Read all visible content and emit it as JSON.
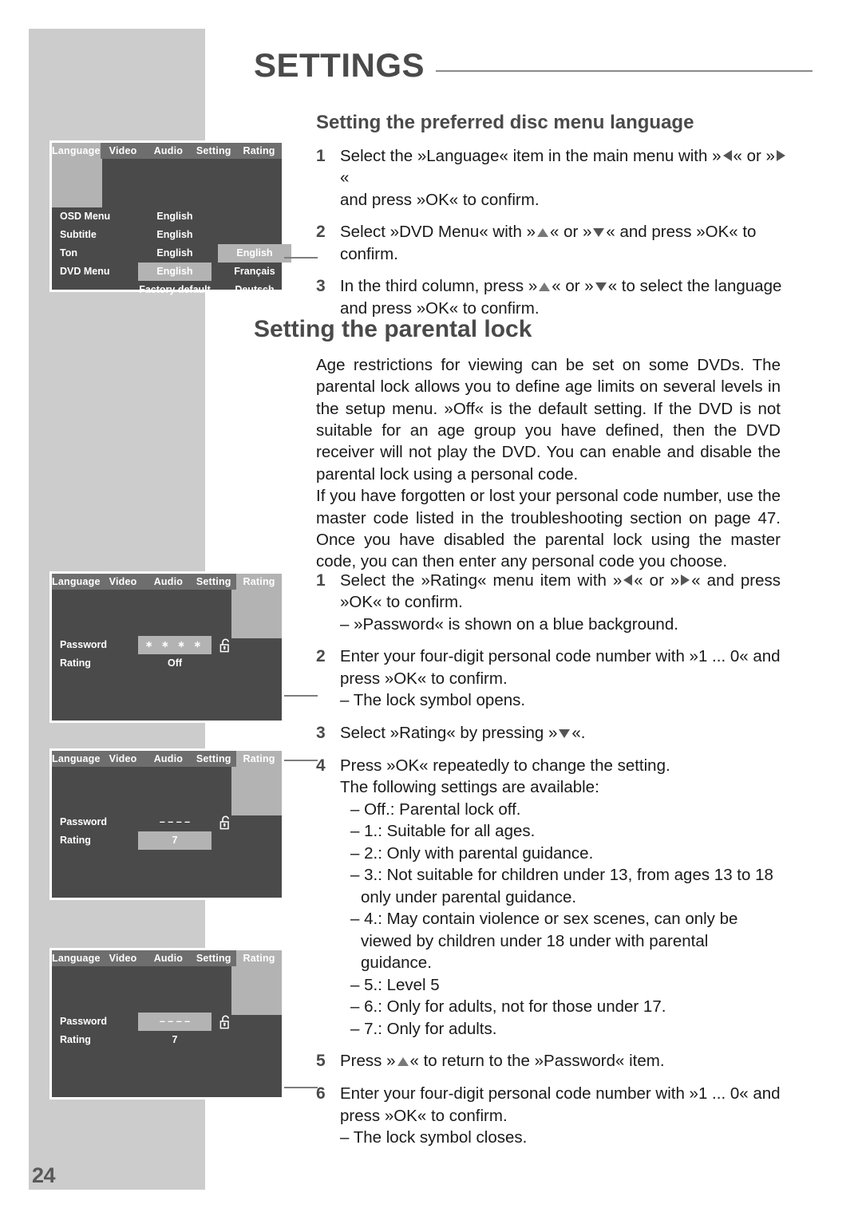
{
  "page": {
    "number": "24",
    "chapter_title": "SETTINGS"
  },
  "sections": {
    "disc_menu_language": {
      "title": "Setting the preferred disc menu language",
      "steps": [
        {
          "num": "1",
          "lines": [
            "Select the »Language« item in the main menu with »",
            "« or »",
            "«",
            "and press »OK« to confirm."
          ]
        },
        {
          "num": "2",
          "lines": [
            "Select »DVD Menu« with »",
            "« or »",
            "« and press »OK« to",
            "confirm."
          ]
        },
        {
          "num": "3",
          "lines": [
            "In the third column, press »",
            "« or »",
            "« to select the language",
            "and press »OK« to confirm."
          ]
        }
      ]
    },
    "parental_lock": {
      "title": "Setting the parental lock",
      "paragraphs": [
        "Age restrictions for viewing can be set on some DVDs. The parental lock allows you to define age limits on several levels in the setup menu. »Off« is the default setting. If the DVD is not suitable for an age group you have defined, then the DVD receiver will not play the DVD. You can enable and disable the parental lock using a personal code.",
        "If you have forgotten or lost your personal code number, use the master code listed in the troubleshooting section on page 47. Once you have disabled the parental lock using the master code, you can then enter any personal code you choose."
      ],
      "steps": [
        {
          "num": "1",
          "text_a": "Select the »Rating« menu item with »",
          "text_b": "« or »",
          "text_c": "« and press »OK« to confirm.",
          "note": "– »Password« is shown on a blue background."
        },
        {
          "num": "2",
          "text_a": "Enter your four-digit personal code number with »1 ... 0« and press »OK« to confirm.",
          "note": "– The lock symbol opens."
        },
        {
          "num": "3",
          "text_a": "Select »Rating« by pressing »",
          "text_b": "«."
        },
        {
          "num": "4",
          "text_a": "Press »OK« repeatedly to change the setting.",
          "text_b": "The following settings are available:",
          "options": [
            "– Off.: Parental lock off.",
            "– 1.: Suitable for all ages.",
            "– 2.: Only with parental guidance.",
            "– 3.: Not suitable for children under 13, from ages 13 to 18 only under parental guidance.",
            "– 4.: May contain violence or sex scenes, can only be viewed by children under 18 under with parental guidance.",
            "– 5.: Level 5",
            "– 6.: Only for adults, not for those under 17.",
            "– 7.: Only for adults."
          ]
        },
        {
          "num": "5",
          "text_a": "Press »",
          "text_b": "« to return to the »Password« item."
        },
        {
          "num": "6",
          "text_a": "Enter your four-digit personal code number with »1 ... 0« and press »OK« to confirm.",
          "note": "– The lock symbol closes."
        }
      ]
    }
  },
  "osd_screens": [
    {
      "id": "language",
      "tabs": [
        "Language",
        "Video",
        "Audio",
        "Setting",
        "Rating"
      ],
      "active_tab": "Language",
      "rows": [
        {
          "label": "OSD Menu",
          "value": "English",
          "value_highlighted": false,
          "third": "",
          "third_highlighted": false
        },
        {
          "label": "Subtitle",
          "value": "English",
          "value_highlighted": false,
          "third": "",
          "third_highlighted": false
        },
        {
          "label": "Ton",
          "value": "English",
          "value_highlighted": false,
          "third": "English",
          "third_highlighted": true
        },
        {
          "label": "DVD Menu",
          "value": "English",
          "value_highlighted": true,
          "third": "Français",
          "third_highlighted": false
        },
        {
          "label": "",
          "value": "Factory default",
          "value_highlighted": false,
          "third": "Deutsch",
          "third_highlighted": false
        }
      ]
    },
    {
      "id": "rating-off",
      "tabs": [
        "Language",
        "Video",
        "Audio",
        "Setting",
        "Rating"
      ],
      "active_tab": "Rating",
      "rows": [
        {
          "label": "Password",
          "value": "∗ ∗ ∗ ∗",
          "value_highlighted": true,
          "lock": "open"
        },
        {
          "label": "Rating",
          "value": "Off",
          "value_highlighted": false
        }
      ]
    },
    {
      "id": "rating-7-selected",
      "tabs": [
        "Language",
        "Video",
        "Audio",
        "Setting",
        "Rating"
      ],
      "active_tab": "Rating",
      "rows": [
        {
          "label": "Password",
          "value": "– – – –",
          "value_highlighted": false,
          "lock": "open"
        },
        {
          "label": "Rating",
          "value": "7",
          "value_highlighted": true
        }
      ]
    },
    {
      "id": "rating-password-selected",
      "tabs": [
        "Language",
        "Video",
        "Audio",
        "Setting",
        "Rating"
      ],
      "active_tab": "Rating",
      "rows": [
        {
          "label": "Password",
          "value": "– – – –",
          "value_highlighted": true,
          "lock": "open"
        },
        {
          "label": "Rating",
          "value": "7",
          "value_highlighted": false
        }
      ]
    }
  ],
  "colors": {
    "panel_gray": "#cccccc",
    "osd_bg": "#4a4a4a",
    "osd_tabbar": "#6e6e6e",
    "osd_highlight": "#b3b3b3",
    "heading_gray": "#4a4a4a"
  }
}
